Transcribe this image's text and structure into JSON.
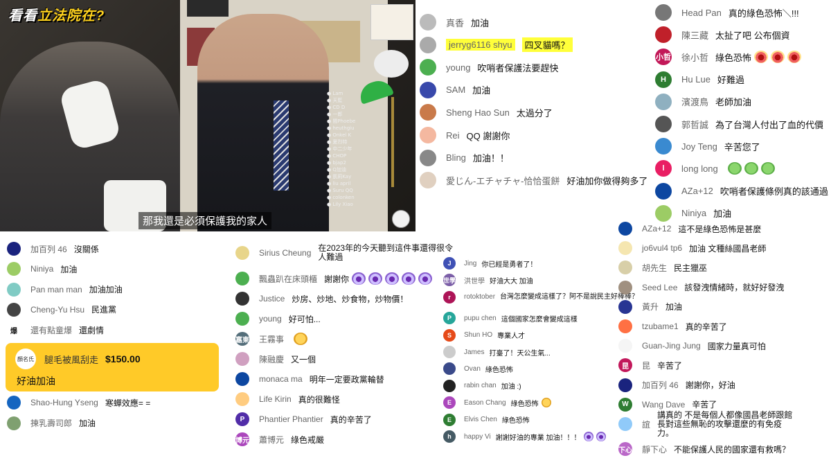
{
  "video": {
    "brand_prefix": "看看",
    "brand_highlight": "立法院在",
    "brand_suffix": "?",
    "subtitle": "那我還是必須保護我的家人",
    "mini_chat": [
      "Lam",
      "天藍",
      "CD D",
      "一郎",
      "閩Phoebe",
      "heuthgiu",
      "Onkel K",
      "夏烈特",
      "中二少年",
      "CHOP",
      "bjap2",
      "Q加油",
      "凱莉Kay",
      "liu april",
      "Suru QQ",
      "colonken",
      "Lily Xiao"
    ]
  },
  "chat_right_top": [
    {
      "name": "Head Pan",
      "msg": "真的綠色恐怖＼!!!",
      "color": "#777",
      "initial": ""
    },
    {
      "name": "陳三藏",
      "msg": "太扯了吧 公布個資",
      "color": "#c0202a",
      "initial": ""
    },
    {
      "name": "徐小哲",
      "msg": "綠色恐怖",
      "color": "#c21858",
      "initial": "小哲",
      "emoji": 3
    },
    {
      "name": "Hu Lue",
      "msg": "好難過",
      "color": "#2e7d32",
      "initial": "H"
    },
    {
      "name": "濱渡鳥",
      "msg": "老師加油",
      "color": "#8fb0c0",
      "initial": ""
    },
    {
      "name": "郭哲誠",
      "msg": "為了台灣人付出了血的代價",
      "color": "#555",
      "initial": ""
    },
    {
      "name": "Joy Teng",
      "msg": "辛苦您了",
      "color": "#3a8ad0",
      "initial": ""
    },
    {
      "name": "long long",
      "msg": "",
      "color": "#e91e63",
      "initial": "l",
      "emoji_sick": 3
    },
    {
      "name": "AZa+12",
      "msg": "吹哨者保護條例真的該通過",
      "color": "#0d47a1",
      "initial": ""
    },
    {
      "name": "Niniya",
      "msg": "加油",
      "color": "#9ccc65",
      "initial": ""
    }
  ],
  "chat_mid_top": [
    {
      "name": "真香",
      "msg": "加油",
      "color": "#bbb",
      "initial": ""
    },
    {
      "name": "jerryg6116 shyu",
      "msg": "四叉貓嗎？",
      "color": "#aaa",
      "initial": "",
      "highlight": true
    },
    {
      "name": "young",
      "msg": "吹哨者保護法要趕快",
      "color": "#4caf50",
      "initial": ""
    },
    {
      "name": "SAM",
      "msg": "加油",
      "color": "#3949ab",
      "initial": ""
    },
    {
      "name": "Sheng Hao Sun",
      "msg": "太過分了",
      "color": "#c97a4a",
      "initial": ""
    },
    {
      "name": "Rei",
      "msg": "QQ 謝謝你",
      "color": "#f4b8a0",
      "initial": ""
    },
    {
      "name": "Bling",
      "msg": "加油！！",
      "color": "#888",
      "initial": ""
    },
    {
      "name": "愛じん-エチャチャ-恰恰蛋餅",
      "msg": "好油加你做得夠多了",
      "color": "#e0d0c0",
      "initial": ""
    }
  ],
  "superchat": {
    "name": "腿毛被風刮走",
    "amount": "$150.00",
    "msg": "好油加油",
    "avatar": "顏名氏"
  },
  "chat_left_bottom_a": [
    {
      "name": "加百列 46",
      "msg": "沒關係",
      "color": "#1a237e",
      "initial": ""
    },
    {
      "name": "Niniya",
      "msg": "加油",
      "color": "#9ccc65",
      "initial": ""
    },
    {
      "name": "Pan man man",
      "msg": "加油加油",
      "color": "#80cbc4",
      "initial": ""
    },
    {
      "name": "Cheng-Yu Hsu",
      "msg": "民進黨",
      "color": "#444",
      "initial": ""
    },
    {
      "name": "還有點童爆",
      "msg": "還劇情",
      "color": "#fff",
      "initial": "爆",
      "dark_text": true
    }
  ],
  "chat_left_bottom_b": [
    {
      "name": "Shao-Hung Yseng",
      "msg": "寒蟬效應= =",
      "color": "#1565c0",
      "initial": ""
    },
    {
      "name": "揀乳壽司郎",
      "msg": "加油",
      "color": "#7fa070",
      "initial": ""
    }
  ],
  "chat_center_bottom": [
    {
      "name": "Sirius Cheung",
      "msg": "在2023年的今天聽到這件事還得很令人難過",
      "color": "#e8d58a",
      "initial": "",
      "wrap": true
    },
    {
      "name": "飄蟲趴在床頭櫃",
      "msg": "謝謝你",
      "color": "#4caf50",
      "initial": "",
      "emoji_purple": 5
    },
    {
      "name": "Justice",
      "msg": "炒房、炒地、炒食物，炒物價！",
      "color": "#333",
      "initial": ""
    },
    {
      "name": "young",
      "msg": "好可怕...",
      "color": "#4caf50",
      "initial": ""
    },
    {
      "name": "王霧事",
      "msg": "",
      "color": "#546e7a",
      "initial": "嘉東",
      "emoji_sad": 1
    },
    {
      "name": "陳融慶",
      "msg": "又一個",
      "color": "#d0a0c0",
      "initial": ""
    },
    {
      "name": "monaca ma",
      "msg": "明年一定要政黨輪替",
      "color": "#0d47a1",
      "initial": ""
    },
    {
      "name": "Life Kirin",
      "msg": "真的很難怪",
      "color": "#ffcc80",
      "initial": ""
    },
    {
      "name": "Phantier Phantier",
      "msg": "真的辛苦了",
      "color": "#512da8",
      "initial": "P"
    },
    {
      "name": "蕭博元",
      "msg": "綠色戒嚴",
      "color": "#ab47bc",
      "initial": "博元"
    }
  ],
  "chat_small_col": [
    {
      "name": "Jing",
      "msg": "你已經是勇者了！",
      "color": "#3f51b5",
      "initial": "J"
    },
    {
      "name": "洪世學",
      "msg": "好油大大 加油",
      "color": "#7b5ea7",
      "initial": "世學"
    },
    {
      "name": "rotoktober",
      "msg": "台灣怎麼變成這樣了？阿不是說民主好棒棒？",
      "color": "#ad1457",
      "initial": "r",
      "wrap": true
    },
    {
      "name": "pupu chen",
      "msg": "這個國家怎麼會變成這樣",
      "color": "#26a69a",
      "initial": "P"
    },
    {
      "name": "Shun HO",
      "msg": "專業人才",
      "color": "#e64a19",
      "initial": "S"
    },
    {
      "name": "James",
      "msg": "打臺了！天公生氣...",
      "color": "#ccc",
      "initial": ""
    },
    {
      "name": "Ovan",
      "msg": "綠色恐怖",
      "color": "#3a4a8a",
      "initial": ""
    },
    {
      "name": "rabin chan",
      "msg": "加油 :)",
      "color": "#222",
      "initial": ""
    },
    {
      "name": "Eason Chang",
      "msg": "綠色恐怖",
      "color": "#ab47bc",
      "initial": "E",
      "emoji_sad": 1
    },
    {
      "name": "Elvis Chen",
      "msg": "綠色恐怖",
      "color": "#2e7d32",
      "initial": "E"
    },
    {
      "name": "happy Vi",
      "msg": "謝謝好油的專業 加油！！！",
      "color": "#455a64",
      "initial": "h",
      "emoji_purple": 2
    }
  ],
  "chat_right_bottom": [
    {
      "name": "AZa+12",
      "msg": "這不是綠色恐怖是甚麼",
      "color": "#0d47a1",
      "initial": ""
    },
    {
      "name": "jo6vul4 tp6",
      "msg": "加油 文種絲國昌老師",
      "color": "#f5e6b0",
      "initial": ""
    },
    {
      "name": "胡先生",
      "msg": "民主獵巫",
      "color": "#d8cfa8",
      "initial": ""
    },
    {
      "name": "Seed Lee",
      "msg": "該發洩情緒時，就好好發洩",
      "color": "#a09080",
      "initial": ""
    },
    {
      "name": "黃升",
      "msg": "加油",
      "color": "#283593",
      "initial": ""
    },
    {
      "name": "tzubame1",
      "msg": "真的辛苦了",
      "color": "#ff7043",
      "initial": ""
    },
    {
      "name": "Guan-Jing Jung",
      "msg": "國家力量真可怕",
      "color": "#f5f5f5",
      "initial": ""
    },
    {
      "name": "昆",
      "msg": "辛苦了",
      "color": "#c2185b",
      "initial": "昆"
    },
    {
      "name": "加百列 46",
      "msg": "謝謝你，好油",
      "color": "#1a237e",
      "initial": ""
    },
    {
      "name": "Wang Dave",
      "msg": "辛苦了",
      "color": "#2e7d32",
      "initial": "W"
    },
    {
      "name": "誼",
      "msg": "講真的 不是每個人都像國昌老師跟館長對這些無恥的攻擊還麼的有免疫力。",
      "color": "#90caf9",
      "initial": "",
      "wrap": true
    },
    {
      "name": "靜下心",
      "msg": "不能保護人民的國家還有救嗎？",
      "color": "#ba68c8",
      "initial": "下心"
    }
  ]
}
